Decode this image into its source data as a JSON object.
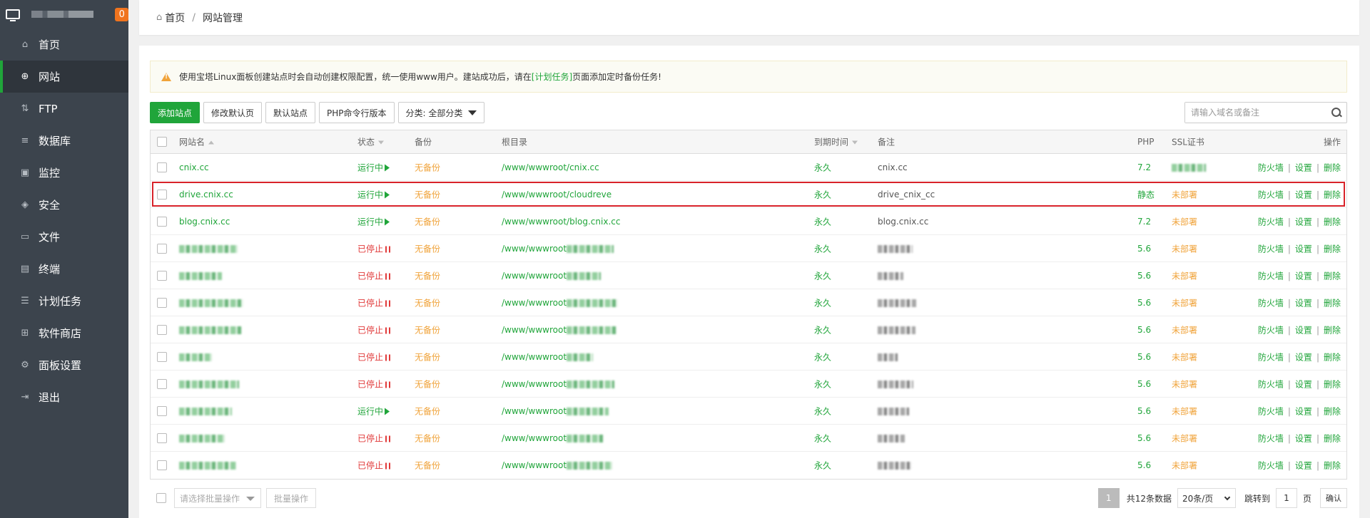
{
  "sidebar": {
    "badge": "0",
    "items": [
      {
        "label": "首页",
        "icon": "home-icon",
        "glyph": "⌂"
      },
      {
        "label": "网站",
        "icon": "globe-icon",
        "glyph": "⊕",
        "active": true
      },
      {
        "label": "FTP",
        "icon": "ftp-icon",
        "glyph": "⇅"
      },
      {
        "label": "数据库",
        "icon": "database-icon",
        "glyph": "≡"
      },
      {
        "label": "监控",
        "icon": "monitor-icon",
        "glyph": "▣"
      },
      {
        "label": "安全",
        "icon": "shield-icon",
        "glyph": "◈"
      },
      {
        "label": "文件",
        "icon": "folder-icon",
        "glyph": "▭"
      },
      {
        "label": "终端",
        "icon": "terminal-icon",
        "glyph": "▤"
      },
      {
        "label": "计划任务",
        "icon": "task-icon",
        "glyph": "☰"
      },
      {
        "label": "软件商店",
        "icon": "grid-icon",
        "glyph": "⊞"
      },
      {
        "label": "面板设置",
        "icon": "gear-icon",
        "glyph": "⚙"
      },
      {
        "label": "退出",
        "icon": "logout-icon",
        "glyph": "⇥"
      }
    ]
  },
  "breadcrumb": {
    "home": "首页",
    "separator": "/",
    "current": "网站管理"
  },
  "alert": {
    "text_before": "使用宝塔Linux面板创建站点时会自动创建权限配置，统一使用www用户。建站成功后，请在",
    "link": "[计划任务]",
    "text_after": "页面添加定时备份任务!"
  },
  "toolbar": {
    "add_site": "添加站点",
    "edit_default_page": "修改默认页",
    "default_site": "默认站点",
    "php_cli_version": "PHP命令行版本",
    "category": "分类: 全部分类"
  },
  "search": {
    "placeholder": "请输入域名或备注"
  },
  "table": {
    "headers": {
      "name": "网站名",
      "status": "状态",
      "backup": "备份",
      "root": "根目录",
      "expire": "到期时间",
      "note": "备注",
      "php": "PHP",
      "ssl": "SSL证书",
      "ops": "操作"
    },
    "op_labels": {
      "firewall": "防火墙",
      "settings": "设置",
      "delete": "删除",
      "sep": "|"
    },
    "rows": [
      {
        "name": "cnix.cc",
        "status": "运行中",
        "running": true,
        "backup": "无备份",
        "root": "/www/wwwroot/cnix.cc",
        "expire": "永久",
        "note": "cnix.cc",
        "php": "7.2",
        "ssl": ""
      },
      {
        "name": "drive.cnix.cc",
        "status": "运行中",
        "running": true,
        "backup": "无备份",
        "root": "/www/wwwroot/cloudreve",
        "expire": "永久",
        "note": "drive_cnix_cc",
        "php": "静态",
        "ssl": "未部署",
        "highlight": true
      },
      {
        "name": "blog.cnix.cc",
        "status": "运行中",
        "running": true,
        "backup": "无备份",
        "root": "/www/wwwroot/blog.cnix.cc",
        "expire": "永久",
        "note": "blog.cnix.cc",
        "php": "7.2",
        "ssl": "未部署"
      },
      {
        "name": "",
        "status": "已停止",
        "running": false,
        "backup": "无备份",
        "root": "/www/wwwroot",
        "expire": "永久",
        "note": "",
        "php": "5.6",
        "ssl": "未部署"
      },
      {
        "name": "",
        "status": "已停止",
        "running": false,
        "backup": "无备份",
        "root": "/www/wwwroot",
        "expire": "永久",
        "note": "",
        "php": "5.6",
        "ssl": "未部署"
      },
      {
        "name": "",
        "status": "已停止",
        "running": false,
        "backup": "无备份",
        "root": "/www/wwwroot",
        "expire": "永久",
        "note": "",
        "php": "5.6",
        "ssl": "未部署"
      },
      {
        "name": "",
        "status": "已停止",
        "running": false,
        "backup": "无备份",
        "root": "/www/wwwroot",
        "expire": "永久",
        "note": "",
        "php": "5.6",
        "ssl": "未部署"
      },
      {
        "name": "",
        "status": "已停止",
        "running": false,
        "backup": "无备份",
        "root": "/www/wwwroot",
        "expire": "永久",
        "note": "",
        "php": "5.6",
        "ssl": "未部署"
      },
      {
        "name": "",
        "status": "已停止",
        "running": false,
        "backup": "无备份",
        "root": "/www/wwwroot",
        "expire": "永久",
        "note": "",
        "php": "5.6",
        "ssl": "未部署"
      },
      {
        "name": "",
        "status": "运行中",
        "running": true,
        "backup": "无备份",
        "root": "/www/wwwroot",
        "expire": "永久",
        "note": "",
        "php": "5.6",
        "ssl": "未部署"
      },
      {
        "name": "",
        "status": "已停止",
        "running": false,
        "backup": "无备份",
        "root": "/www/wwwroot",
        "expire": "永久",
        "note": "",
        "php": "5.6",
        "ssl": "未部署"
      },
      {
        "name": "",
        "status": "已停止",
        "running": false,
        "backup": "无备份",
        "root": "/www/wwwroot",
        "expire": "永久",
        "note": "",
        "php": "5.6",
        "ssl": "未部署"
      }
    ]
  },
  "footer": {
    "batch_select_placeholder": "请选择批量操作",
    "batch_button": "批量操作",
    "current_page": "1",
    "total": "共12条数据",
    "per_page": "20条/页",
    "jump_to": "跳转到",
    "page_input": "1",
    "page_unit": "页",
    "confirm": "确认"
  }
}
